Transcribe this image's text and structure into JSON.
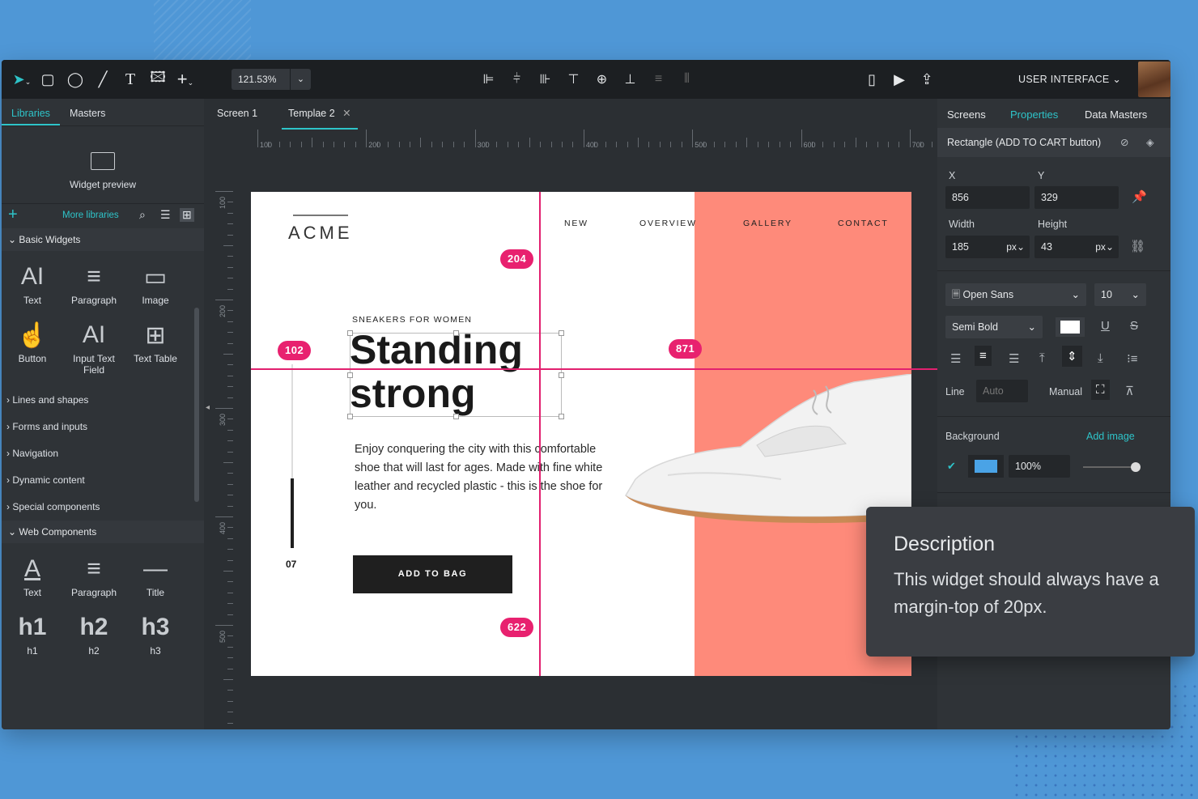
{
  "toolbar": {
    "tools": [
      "pointer-icon",
      "rectangle-icon",
      "ellipse-icon",
      "line-icon",
      "text-tool-icon",
      "image-tool-icon",
      "add-icon"
    ],
    "zoom": "121.53%",
    "align_tools": [
      "align-left-icon",
      "align-center-h-icon",
      "align-right-icon",
      "align-top-icon",
      "align-middle-icon",
      "align-bottom-icon",
      "distribute-v-icon",
      "distribute-h-icon"
    ],
    "right_tools": [
      "device-icon",
      "play-icon",
      "export-icon"
    ],
    "project": "USER INTERFACE"
  },
  "left_panel": {
    "tabs": [
      "Libraries",
      "Masters"
    ],
    "preview_label": "Widget preview",
    "more_libraries": "More libraries",
    "basic_section": "Basic Widgets",
    "basic_widgets": [
      {
        "icon": "AI",
        "label": "Text"
      },
      {
        "icon": "≡",
        "label": "Paragraph"
      },
      {
        "icon": "▭",
        "label": "Image"
      },
      {
        "icon": "☝",
        "label": "Button"
      },
      {
        "icon": "AI",
        "label": "Input Text Field"
      },
      {
        "icon": "⊞",
        "label": "Text Table"
      }
    ],
    "categories": [
      "Lines and shapes",
      "Forms and inputs",
      "Navigation",
      "Dynamic content",
      "Special components"
    ],
    "web_section": "Web Components",
    "web_widgets": [
      {
        "icon": "A",
        "label": "Text"
      },
      {
        "icon": "≡",
        "label": "Paragraph"
      },
      {
        "icon": "—",
        "label": "Title"
      },
      {
        "icon": "h1",
        "label": "h1"
      },
      {
        "icon": "h2",
        "label": "h2"
      },
      {
        "icon": "h3",
        "label": "h3"
      }
    ]
  },
  "canvas": {
    "tabs": [
      "Screen 1",
      "Templae 2"
    ],
    "ruler_h": [
      "100",
      "200",
      "300",
      "400",
      "500",
      "600",
      "700"
    ],
    "ruler_v": [
      "100",
      "200",
      "300",
      "400",
      "500"
    ],
    "page": {
      "logo": "ACME",
      "nav": [
        "NEW",
        "OVERVIEW",
        "GALLERY",
        "CONTACT"
      ],
      "kicker": "SNEAKERS FOR WOMEN",
      "headline_1": "Standing",
      "headline_2": "strong",
      "body": "Enjoy conquering the city with this comfortable shoe that will last for ages. Made with fine white leather and recycled plastic - this is the shoe for you.",
      "cta": "ADD TO BAG",
      "counter": "07"
    },
    "measures": {
      "top": "204",
      "left": "102",
      "right": "871",
      "bottom": "622"
    },
    "accent_color": "#fe8a7a",
    "guide_color": "#e2206f"
  },
  "right_panel": {
    "tabs": [
      "Screens",
      "Properties",
      "Data Masters"
    ],
    "selection": "Rectangle (ADD TO CART button)",
    "x_label": "X",
    "y_label": "Y",
    "x": "856",
    "y": "329",
    "width_label": "Width",
    "height_label": "Height",
    "width": "185",
    "height": "43",
    "unit": "px",
    "font": "Open Sans",
    "font_size": "10",
    "font_weight": "Semi Bold",
    "line_label": "Line",
    "line_value": "Auto",
    "manual_label": "Manual",
    "background_label": "Background",
    "add_image": "Add image",
    "opacity": "100%",
    "bg_color": "#4aa3e6"
  },
  "tooltip": {
    "title": "Description",
    "text": "This widget should always have a margin-top of 20px."
  }
}
